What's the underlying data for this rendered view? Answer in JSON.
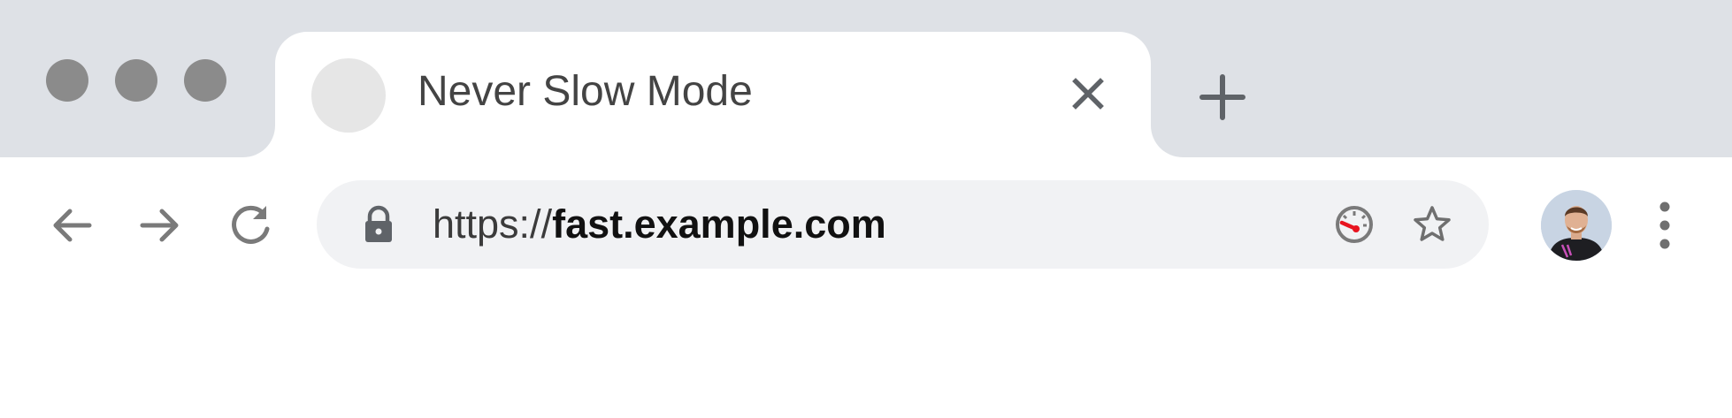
{
  "window": {
    "controls": [
      "close",
      "minimize",
      "maximize"
    ]
  },
  "tab": {
    "title": "Never Slow Mode",
    "favicon": "placeholder-circle",
    "close_icon": "close-icon"
  },
  "new_tab_icon": "plus-icon",
  "nav": {
    "back_icon": "arrow-left-icon",
    "forward_icon": "arrow-right-icon",
    "reload_icon": "reload-icon"
  },
  "omnibox": {
    "lock_icon": "lock-icon",
    "scheme": "https://",
    "host": "fast.example.com",
    "speed_icon": "speedometer-icon",
    "bookmark_icon": "star-icon"
  },
  "profile_icon": "avatar",
  "menu_icon": "kebab-menu-icon",
  "colors": {
    "tabstrip_bg": "#dee1e6",
    "omnibox_bg": "#f1f2f4",
    "gauge_needle": "#e8141f",
    "icon_gray": "#7a7a7a"
  }
}
